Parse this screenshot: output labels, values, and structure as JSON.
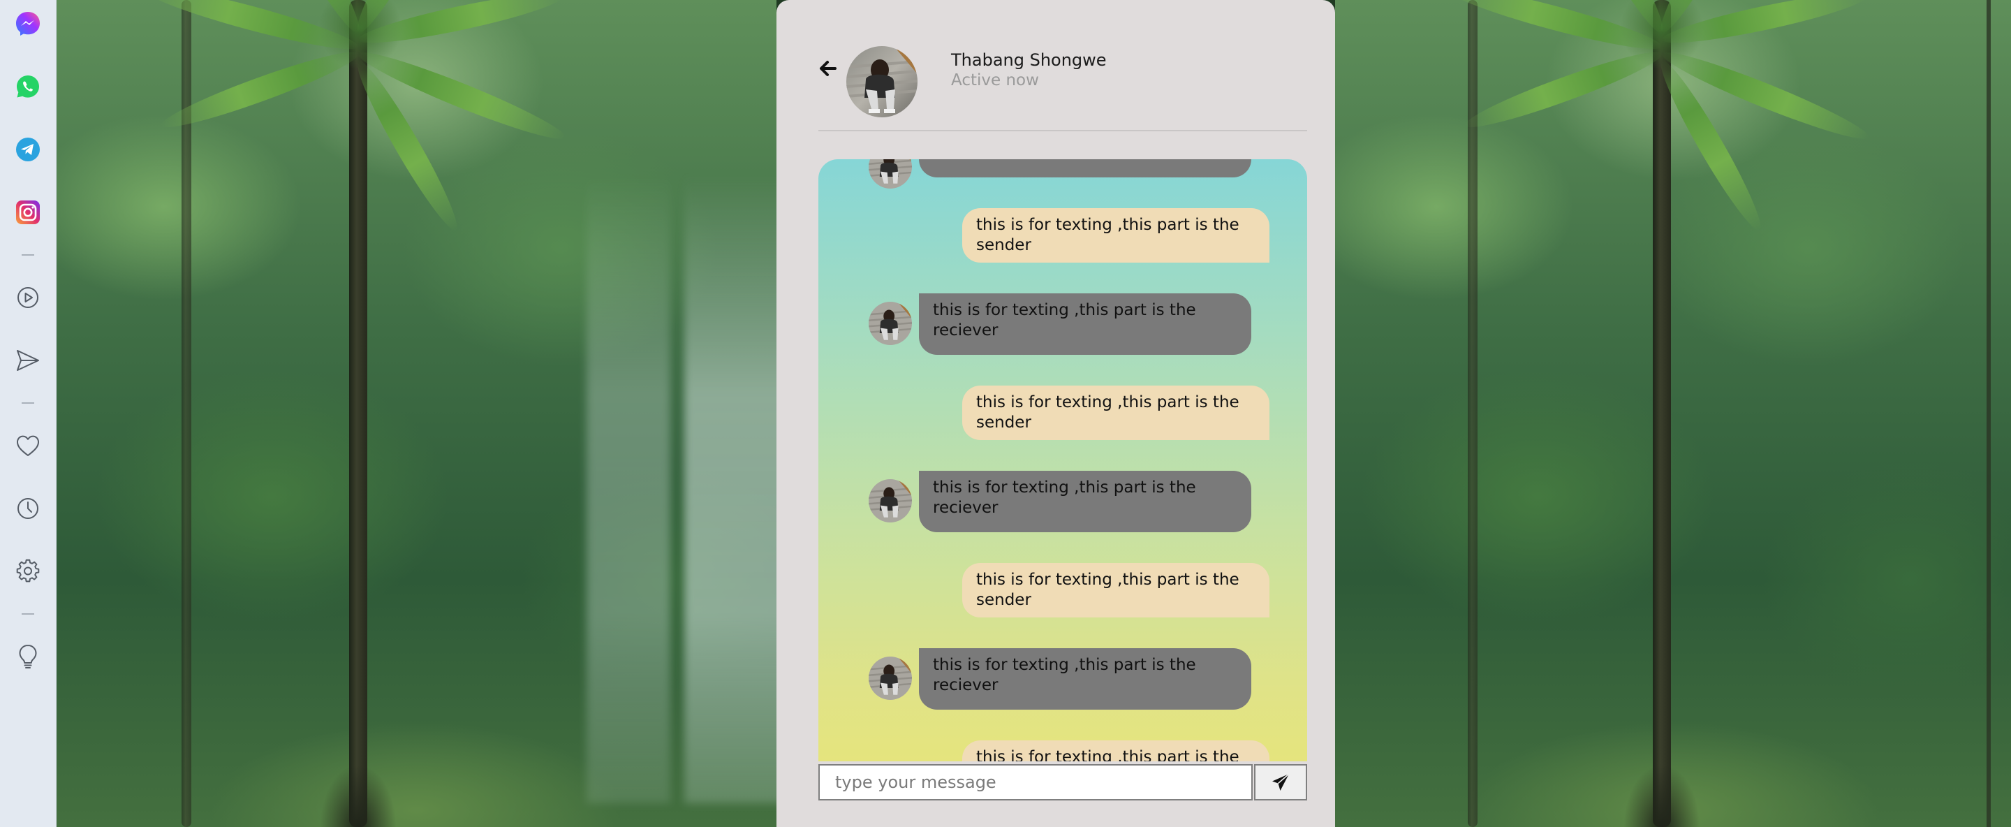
{
  "sidebar": {
    "apps": [
      {
        "name": "messenger",
        "icon": "messenger-icon",
        "color": "#a033ff"
      },
      {
        "name": "whatsapp",
        "icon": "whatsapp-icon",
        "color": "#25d366"
      },
      {
        "name": "telegram",
        "icon": "telegram-icon",
        "color": "#2aa3df"
      },
      {
        "name": "instagram",
        "icon": "instagram-icon",
        "color": "#d6297a"
      }
    ],
    "tools": [
      {
        "name": "play",
        "icon": "play-circle-icon"
      },
      {
        "name": "send",
        "icon": "send-icon"
      },
      {
        "name": "favorites",
        "icon": "heart-icon"
      },
      {
        "name": "history",
        "icon": "clock-icon"
      },
      {
        "name": "settings",
        "icon": "gear-icon"
      },
      {
        "name": "tips",
        "icon": "lightbulb-icon"
      }
    ]
  },
  "chat": {
    "contact": {
      "name": "Thabang Shongwe",
      "status": "Active now"
    },
    "messages": [
      {
        "direction": "received",
        "text": ""
      },
      {
        "direction": "sent",
        "text": "this is for texting ,this part is the sender"
      },
      {
        "direction": "received",
        "text": "this is for texting ,this part is the reciever"
      },
      {
        "direction": "sent",
        "text": "this is for texting ,this part is the sender"
      },
      {
        "direction": "received",
        "text": "this is for texting ,this part is the reciever"
      },
      {
        "direction": "sent",
        "text": "this is for texting ,this part is the sender"
      },
      {
        "direction": "received",
        "text": "this is for texting ,this part is the reciever"
      },
      {
        "direction": "sent",
        "text": "this is for texting ,this part is the sender"
      }
    ],
    "composer": {
      "placeholder": "type your message",
      "value": ""
    }
  },
  "colors": {
    "sent_bubble": "#f0dcb6",
    "received_bubble": "#7a7a7a",
    "chat_panel": "#e0dcdc",
    "sidebar": "#e3e9f1"
  },
  "icons": {
    "back": "arrow-left-icon",
    "send": "paper-plane-icon"
  }
}
